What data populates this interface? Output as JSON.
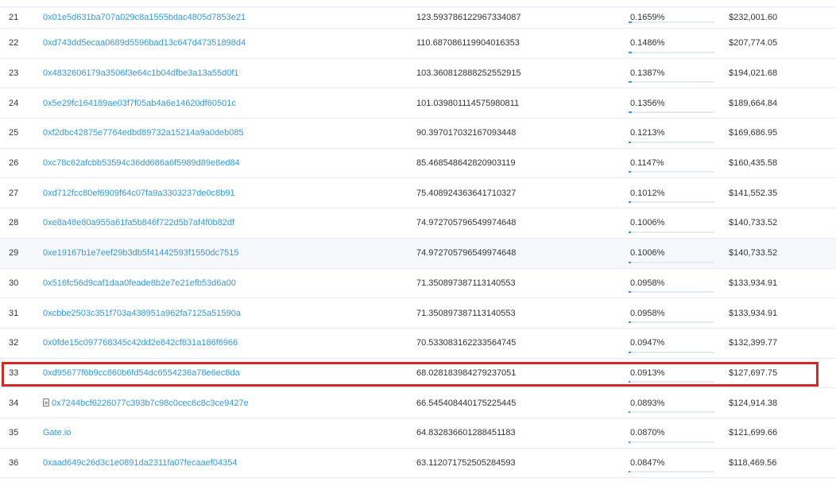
{
  "colors": {
    "link": "#3498db",
    "highlight": "#d62727",
    "text": "#333333",
    "row_alt": "#f7f8fb",
    "border": "#e7eaf3"
  },
  "highlighted_rank": "33",
  "rows": [
    {
      "rank": "21",
      "address": "0x01e5d631ba707a029c8a1555bdac4805d7853e21",
      "quantity": "123.593786122967334087",
      "percentage": "0.1659%",
      "percent_value": 0.1659,
      "value": "$232,001.60"
    },
    {
      "rank": "22",
      "address": "0xd743dd5ecaa0689d5596bad13c647d47351898d4",
      "quantity": "110.687086119904016353",
      "percentage": "0.1486%",
      "percent_value": 0.1486,
      "value": "$207,774.05"
    },
    {
      "rank": "23",
      "address": "0x4832606179a3506f3e64c1b04dfbe3a13a55d0f1",
      "quantity": "103.360812888252552915",
      "percentage": "0.1387%",
      "percent_value": 0.1387,
      "value": "$194,021.68"
    },
    {
      "rank": "24",
      "address": "0x5e29fc164189ae03f7f05ab4a6e14620df60501c",
      "quantity": "101.039801114575980811",
      "percentage": "0.1356%",
      "percent_value": 0.1356,
      "value": "$189,664.84"
    },
    {
      "rank": "25",
      "address": "0xf2dbc42875e7764edbd89732a15214a9a0deb085",
      "quantity": "90.397017032167093448",
      "percentage": "0.1213%",
      "percent_value": 0.1213,
      "value": "$169,686.95"
    },
    {
      "rank": "26",
      "address": "0xc78c62afcbb53594c36dd686a6f5989d89e8ed84",
      "quantity": "85.468548642820903119",
      "percentage": "0.1147%",
      "percent_value": 0.1147,
      "value": "$160,435.58"
    },
    {
      "rank": "27",
      "address": "0xd712fcc80ef6909f64c07fa9a3303237de0c8b91",
      "quantity": "75.408924363641710327",
      "percentage": "0.1012%",
      "percent_value": 0.1012,
      "value": "$141,552.35"
    },
    {
      "rank": "28",
      "address": "0xe8a48e80a955a61fa5b846f722d5b7af4f0b82df",
      "quantity": "74.972705796549974648",
      "percentage": "0.1006%",
      "percent_value": 0.1006,
      "value": "$140,733.52"
    },
    {
      "rank": "29",
      "address": "0xe19167b1e7eef29b3db5f41442593f1550dc7515",
      "quantity": "74.972705796549974648",
      "percentage": "0.1006%",
      "percent_value": 0.1006,
      "value": "$140,733.52"
    },
    {
      "rank": "30",
      "address": "0x516fc56d9caf1daa0feade8b2e7e21efb53d6a00",
      "quantity": "71.350897387113140553",
      "percentage": "0.0958%",
      "percent_value": 0.0958,
      "value": "$133,934.91"
    },
    {
      "rank": "31",
      "address": "0xcbbe2503c351f703a438951a962fa7125a51590a",
      "quantity": "71.350897387113140553",
      "percentage": "0.0958%",
      "percent_value": 0.0958,
      "value": "$133,934.91"
    },
    {
      "rank": "32",
      "address": "0x0fde15c097768345c42dd2e842cf831a186f6966",
      "quantity": "70.533083162233564745",
      "percentage": "0.0947%",
      "percent_value": 0.0947,
      "value": "$132,399.77"
    },
    {
      "rank": "33",
      "address": "0xd95677f6b9cc860b6fd54dc6554236a78e6ec8da",
      "quantity": "68.028183984279237051",
      "percentage": "0.0913%",
      "percent_value": 0.0913,
      "value": "$127,697.75"
    },
    {
      "rank": "34",
      "address": "0x7244bcf6226077c393b7c98c0cec6c8c3ce9427e",
      "quantity": "66.545408440175225445",
      "percentage": "0.0893%",
      "percent_value": 0.0893,
      "value": "$124,914.38",
      "icon": "contract-file-icon"
    },
    {
      "rank": "35",
      "address": "Gate.io",
      "quantity": "64.832836601288451183",
      "percentage": "0.0870%",
      "percent_value": 0.087,
      "value": "$121,699.66"
    },
    {
      "rank": "36",
      "address": "0xaad649c26d3c1e0891da2311fa07fecaaef04354",
      "quantity": "63.112071752505284593",
      "percentage": "0.0847%",
      "percent_value": 0.0847,
      "value": "$118,469.56"
    }
  ]
}
